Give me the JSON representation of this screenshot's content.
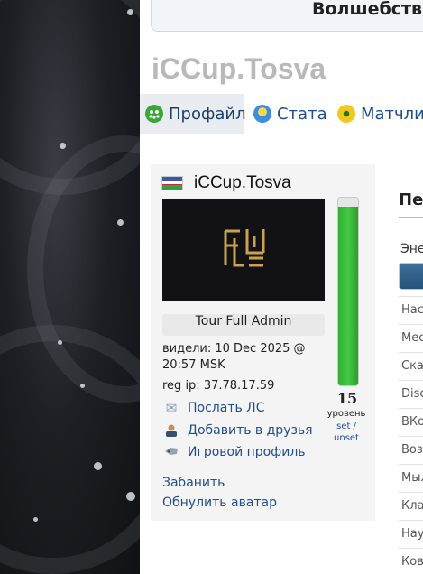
{
  "banner": {
    "text": "Волшебств"
  },
  "page_title": "iCCup.Tosva",
  "tabs": [
    {
      "label": "Профайл",
      "icon": "profile-icon",
      "active": true
    },
    {
      "label": "Стата",
      "icon": "stats-icon",
      "active": false
    },
    {
      "label": "Матчлис",
      "icon": "matchlist-icon",
      "active": false
    }
  ],
  "profile": {
    "username": "iCCup.Tosva",
    "flag": "flag-icon",
    "avatar_text": "TOKYO REVENGERS",
    "badge": "Tour Full Admin",
    "seen": "видели: 10 Dec 2025 @ 20:57 MSK",
    "reg_ip": "reg ip: 37.78.17.59",
    "actions": [
      {
        "label": "Послать ЛС",
        "icon": "envelope-icon"
      },
      {
        "label": "Добавить в друзья",
        "icon": "add-friend-icon"
      },
      {
        "label": "Игровой профиль",
        "icon": "game-profile-icon"
      }
    ],
    "ban_link": "Забанить",
    "reset_avatar_link": "Обнулить аватар",
    "level": {
      "value": "15",
      "label": "уровень",
      "set_label": "set /",
      "unset_label": "unset",
      "fill_fraction": 0.95
    }
  },
  "right": {
    "heading": "Пе",
    "energy_label": "Эне",
    "rows": [
      "Нас",
      "Мес",
      "Ска",
      "Disc",
      "ВКо",
      "Воз",
      "Мыл",
      "Кла",
      "Нау",
      "Ков"
    ]
  },
  "colors": {
    "link": "#1f4e8c",
    "level_fill": "#2fb12f",
    "title_gray": "#b9b9b9"
  }
}
